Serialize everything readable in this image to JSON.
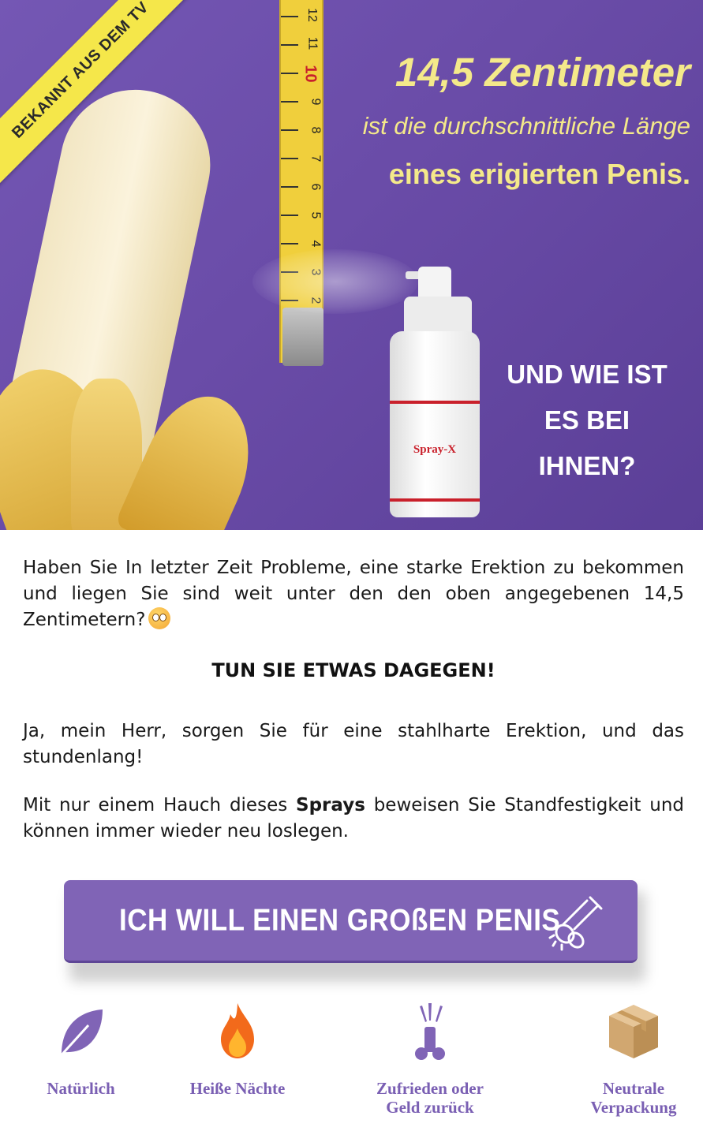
{
  "hero": {
    "ribbon": "BEKANNT AUS DEM TV",
    "headline_big": "14,5 Zentimeter",
    "headline_mid": "ist die durchschnittliche Länge",
    "headline_small": "eines erigierten Penis.",
    "question_line1": "UND WIE IST",
    "question_line2": "ES BEI IHNEN?",
    "bottle_label": "Spray-X",
    "tape_numbers": [
      "12",
      "11",
      "10",
      "9",
      "8",
      "7",
      "6",
      "5",
      "4",
      "3",
      "2"
    ],
    "colors": {
      "background": "#6a4ca8",
      "headline": "#f4e98a",
      "ribbon": "#f5e74a",
      "tape": "#f0cf3c",
      "bottle_stripe": "#c9202b"
    }
  },
  "content": {
    "paragraph1": "Haben Sie In letzter Zeit Probleme, eine starke Erektion zu bekommen und liegen Sie sind weit unter den den oben angegebenen 14,5 Zentimetern?",
    "emoji": "flushed-face-emoji",
    "heading": "TUN SIE ETWAS DAGEGEN!",
    "paragraph2": "Ja, mein Herr, sorgen Sie für eine stahlharte Erektion, und das stundenlang!",
    "paragraph3_before": "Mit nur einem Hauch dieses ",
    "paragraph3_bold": "Sprays",
    "paragraph3_after": " beweisen Sie Standfestigkeit und können immer wieder neu loslegen."
  },
  "cta": {
    "label": "ICH WILL EINEN GROßEN PENIS",
    "icon": "penis-outline-icon",
    "color": "#8064b6"
  },
  "features": [
    {
      "label": "Natürlich",
      "icon": "leaf-icon"
    },
    {
      "label": "Heiße Nächte",
      "icon": "flame-icon"
    },
    {
      "label_line1": "Zufrieden oder",
      "label_line2": "Geld zurück",
      "icon": "satisfaction-icon"
    },
    {
      "label_line1": "Neutrale",
      "label_line2": "Verpackung",
      "icon": "package-icon"
    }
  ],
  "feature_label_color": "#7a5fb3"
}
